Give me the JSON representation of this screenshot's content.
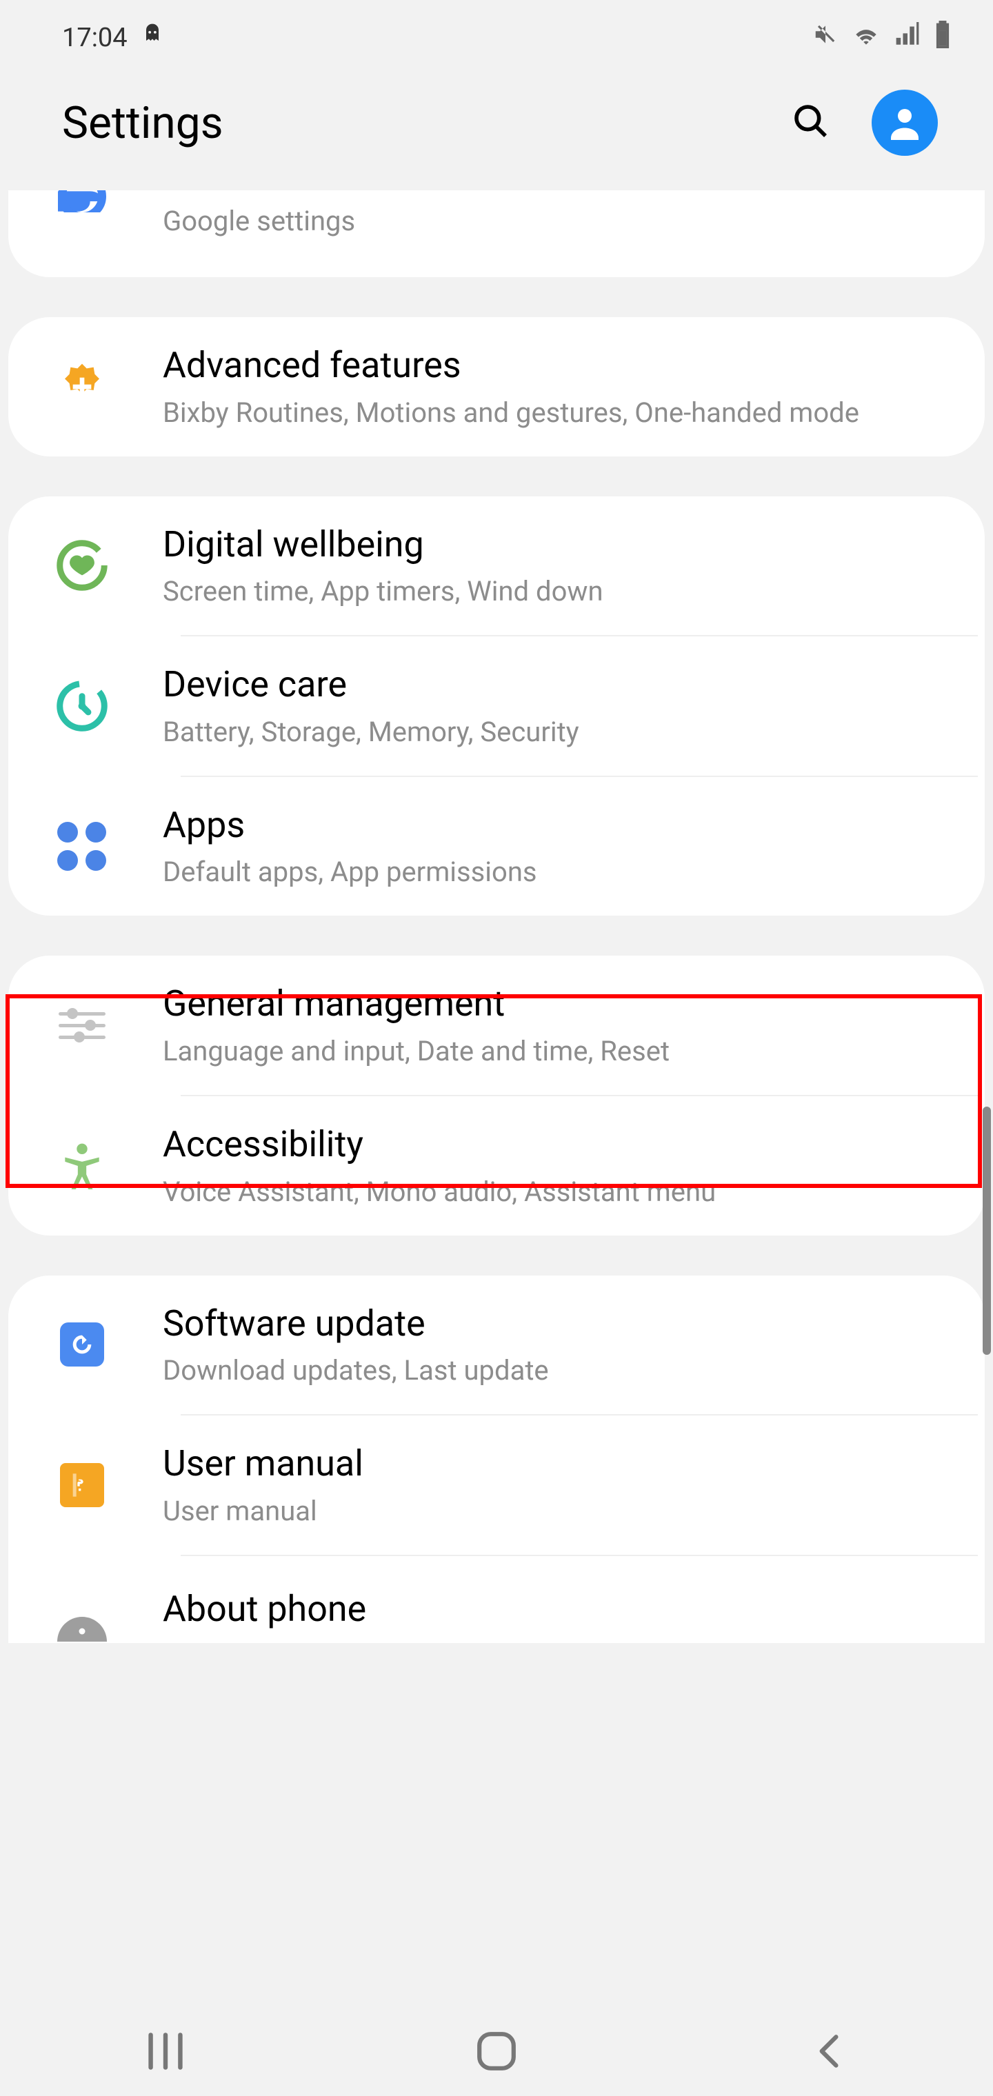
{
  "status": {
    "time": "17:04"
  },
  "header": {
    "title": "Settings"
  },
  "items": {
    "google": {
      "sub": "Google settings"
    },
    "advanced": {
      "title": "Advanced features",
      "sub": "Bixby Routines, Motions and gestures, One-handed mode"
    },
    "wellbeing": {
      "title": "Digital wellbeing",
      "sub": "Screen time, App timers, Wind down"
    },
    "devicecare": {
      "title": "Device care",
      "sub": "Battery, Storage, Memory, Security"
    },
    "apps": {
      "title": "Apps",
      "sub": "Default apps, App permissions"
    },
    "general": {
      "title": "General management",
      "sub": "Language and input, Date and time, Reset"
    },
    "accessibility": {
      "title": "Accessibility",
      "sub": "Voice Assistant, Mono audio, Assistant menu"
    },
    "software": {
      "title": "Software update",
      "sub": "Download updates, Last update"
    },
    "manual": {
      "title": "User manual",
      "sub": "User manual"
    },
    "about": {
      "title": "About phone"
    }
  }
}
